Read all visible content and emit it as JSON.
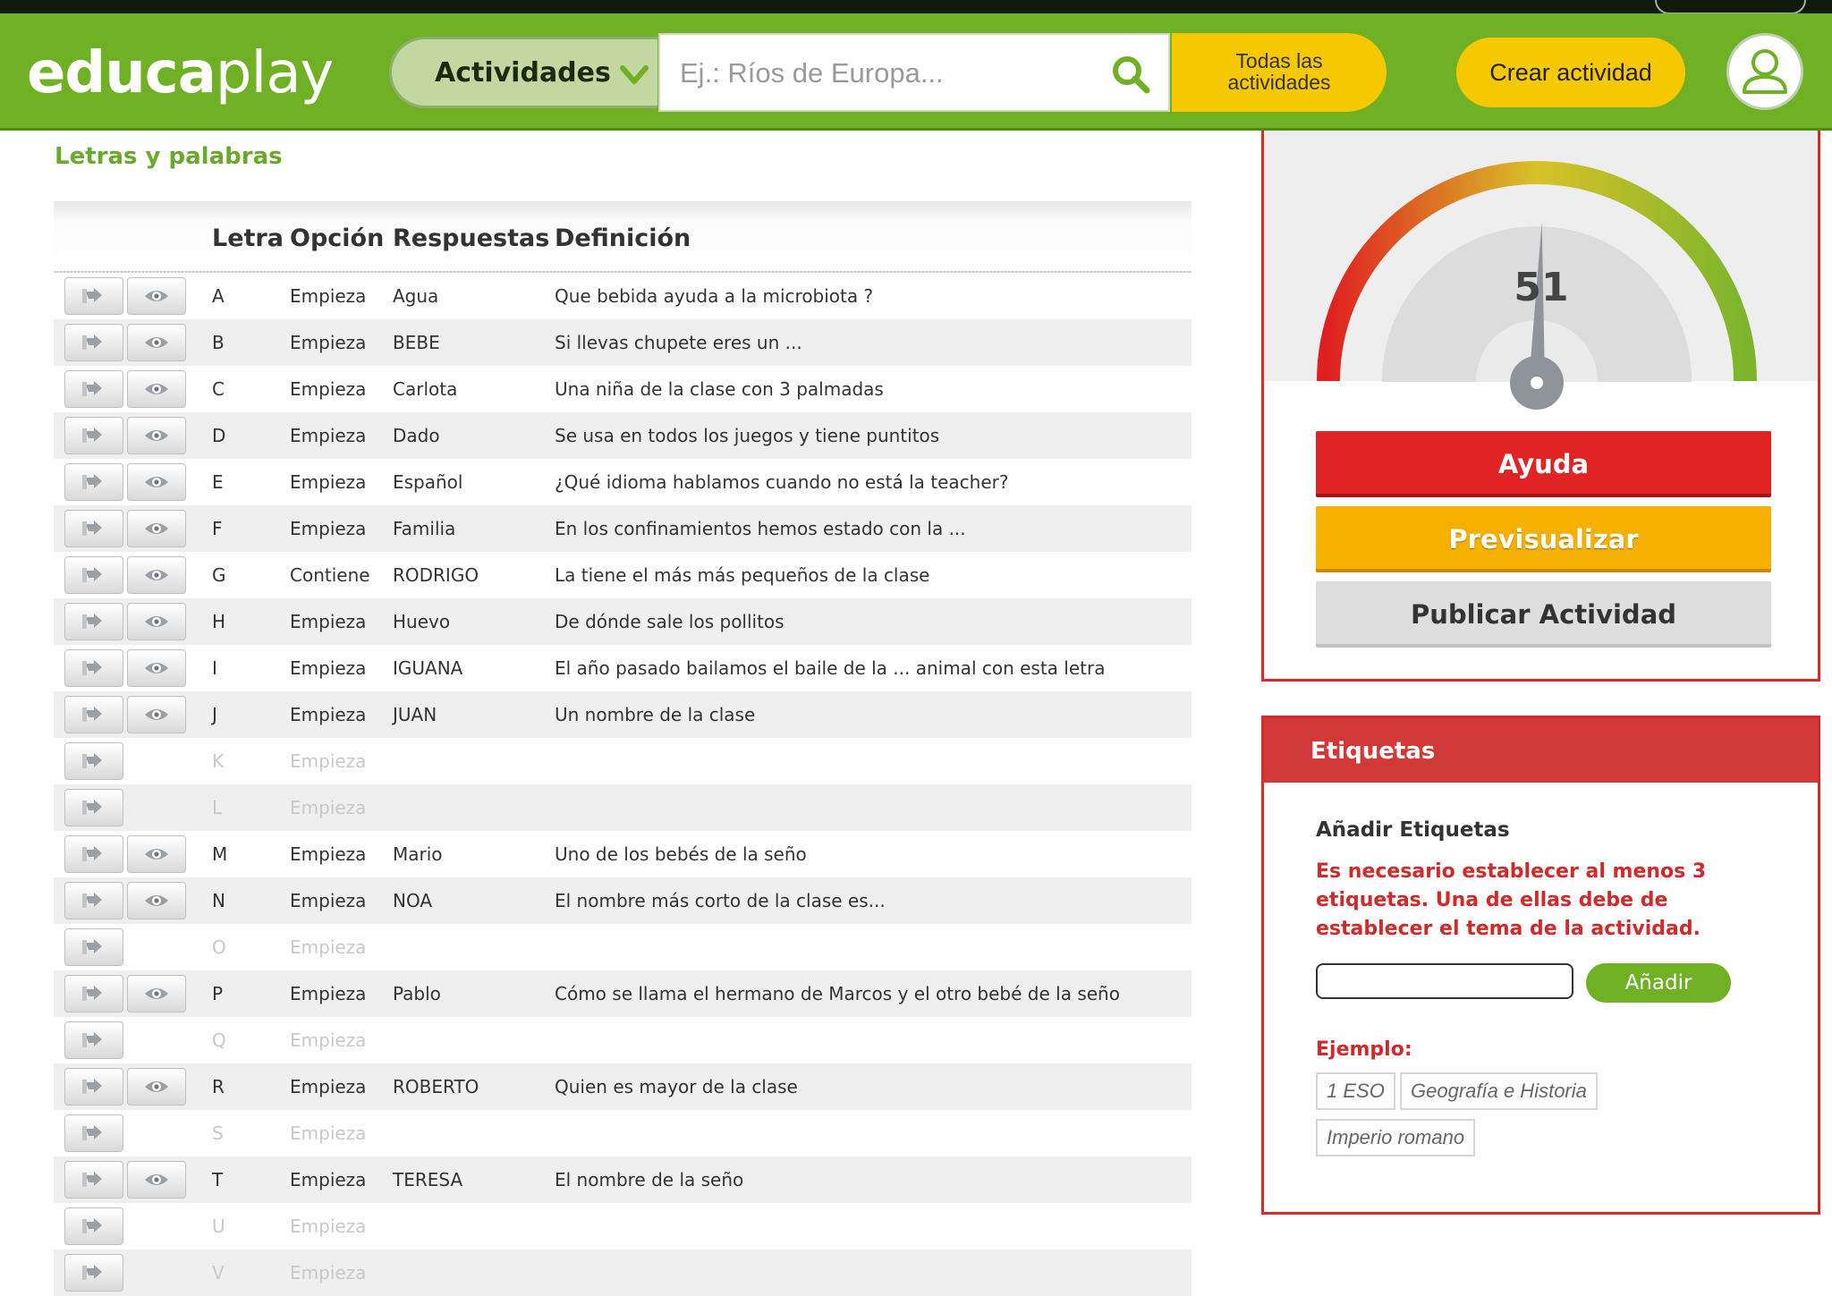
{
  "header": {
    "logo_bold": "educa",
    "logo_light": "play",
    "category_select": "Actividades",
    "search_placeholder": "Ej.: Ríos de Europa...",
    "all_activities_line1": "Todas las",
    "all_activities_line2": "actividades",
    "create_button": "Crear actividad"
  },
  "section_title": "Letras y palabras",
  "table": {
    "headers": {
      "letter": "Letra",
      "option": "Opción",
      "answer": "Respuestas",
      "definition": "Definición"
    },
    "rows": [
      {
        "letter": "A",
        "option": "Empieza",
        "answer": "Agua",
        "definition": "Que bebida ayuda a la microbiota ?",
        "filled": true
      },
      {
        "letter": "B",
        "option": "Empieza",
        "answer": "BEBE",
        "definition": "Si llevas chupete eres un ...",
        "filled": true
      },
      {
        "letter": "C",
        "option": "Empieza",
        "answer": "Carlota",
        "definition": "Una niña de la clase con 3 palmadas",
        "filled": true
      },
      {
        "letter": "D",
        "option": "Empieza",
        "answer": "Dado",
        "definition": "Se usa en todos los juegos y tiene puntitos",
        "filled": true
      },
      {
        "letter": "E",
        "option": "Empieza",
        "answer": "Español",
        "definition": "¿Qué idioma hablamos cuando no está la teacher?",
        "filled": true
      },
      {
        "letter": "F",
        "option": "Empieza",
        "answer": "Familia",
        "definition": "En los confinamientos hemos estado con la ...",
        "filled": true
      },
      {
        "letter": "G",
        "option": "Contiene",
        "answer": "RODRIGO",
        "definition": "La tiene el más más pequeños de la clase",
        "filled": true
      },
      {
        "letter": "H",
        "option": "Empieza",
        "answer": "Huevo",
        "definition": "De dónde sale los pollitos",
        "filled": true
      },
      {
        "letter": "I",
        "option": "Empieza",
        "answer": "IGUANA",
        "definition": "El año pasado bailamos el baile de la ... animal con esta letra",
        "filled": true
      },
      {
        "letter": "J",
        "option": "Empieza",
        "answer": "JUAN",
        "definition": "Un nombre de la clase",
        "filled": true
      },
      {
        "letter": "K",
        "option": "Empieza",
        "answer": "",
        "definition": "",
        "filled": false
      },
      {
        "letter": "L",
        "option": "Empieza",
        "answer": "",
        "definition": "",
        "filled": false
      },
      {
        "letter": "M",
        "option": "Empieza",
        "answer": "Mario",
        "definition": "Uno de los bebés de la seño",
        "filled": true
      },
      {
        "letter": "N",
        "option": "Empieza",
        "answer": "NOA",
        "definition": "El nombre más corto de la clase es...",
        "filled": true
      },
      {
        "letter": "O",
        "option": "Empieza",
        "answer": "",
        "definition": "",
        "filled": false
      },
      {
        "letter": "P",
        "option": "Empieza",
        "answer": "Pablo",
        "definition": "Cómo se llama el hermano de Marcos y el otro bebé de la seño",
        "filled": true
      },
      {
        "letter": "Q",
        "option": "Empieza",
        "answer": "",
        "definition": "",
        "filled": false
      },
      {
        "letter": "R",
        "option": "Empieza",
        "answer": "ROBERTO",
        "definition": "Quien es mayor de la clase",
        "filled": true
      },
      {
        "letter": "S",
        "option": "Empieza",
        "answer": "",
        "definition": "",
        "filled": false
      },
      {
        "letter": "T",
        "option": "Empieza",
        "answer": "TERESA",
        "definition": "El nombre de la seño",
        "filled": true
      },
      {
        "letter": "U",
        "option": "Empieza",
        "answer": "",
        "definition": "",
        "filled": false
      },
      {
        "letter": "V",
        "option": "Empieza",
        "answer": "",
        "definition": "",
        "filled": false
      }
    ]
  },
  "quality_gauge": {
    "value": 51,
    "max": 100
  },
  "actions": {
    "help": "Ayuda",
    "preview": "Previsualizar",
    "publish": "Publicar Actividad"
  },
  "tags": {
    "title": "Etiquetas",
    "subtitle": "Añadir Etiquetas",
    "warning": "Es necesario establecer al menos 3 etiquetas. Una de ellas debe de establecer el tema de la actividad.",
    "input_value": "",
    "add_button": "Añadir",
    "example_label": "Ejemplo:",
    "examples": [
      "1 ESO",
      "Geografía e Historia",
      "Imperio romano"
    ]
  },
  "colors": {
    "brand_green": "#6fb024",
    "yellow": "#f6c800",
    "red": "#d13838",
    "orange": "#f5b000"
  }
}
